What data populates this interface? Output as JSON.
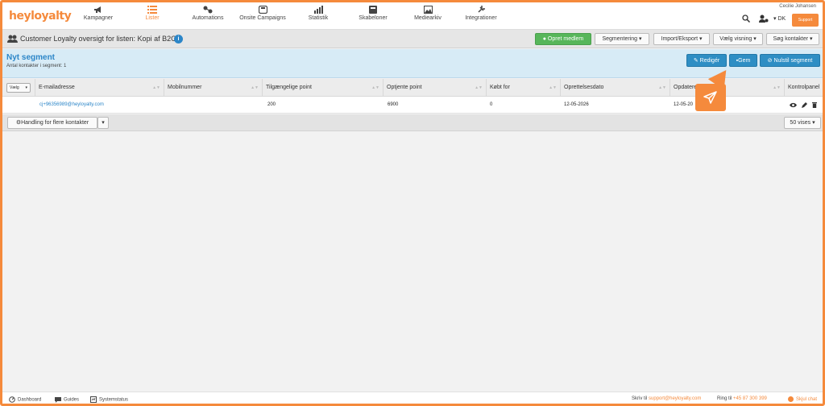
{
  "brand": {
    "logo_text": "heyloyalty",
    "accent": "#f58a3c",
    "blue": "#2c86c8",
    "green": "#57b65a"
  },
  "nav": {
    "items": [
      {
        "label": "Kampagner",
        "icon": "megaphone-icon"
      },
      {
        "label": "Lister",
        "icon": "list-icon",
        "active": true
      },
      {
        "label": "Automations",
        "icon": "automations-icon"
      },
      {
        "label": "Onsite Campaigns",
        "icon": "onsite-icon"
      },
      {
        "label": "Statistik",
        "icon": "bar-chart-icon"
      },
      {
        "label": "Skabeloner",
        "icon": "template-icon"
      },
      {
        "label": "Mediearkiv",
        "icon": "image-icon"
      },
      {
        "label": "Integrationer",
        "icon": "plug-icon"
      }
    ],
    "user_name": "Cecilie Johansen",
    "language": "DK",
    "support_label": "Support"
  },
  "titlebar": {
    "title": "Customer Loyalty oversigt for listen: Kopi af B2C",
    "info_label": "i",
    "create_member": "Opret medlem",
    "segmentation": "Segmentering",
    "import_export": "Import/Eksport",
    "choose_view": "Vælg visning",
    "search_contacts": "Søg kontakter"
  },
  "segment": {
    "title": "Nyt segment",
    "count_label": "Antal kontakter i segment: 1",
    "edit_label": "Redigér",
    "save_label": "Gem",
    "reset_label": "Nulstil segment"
  },
  "table": {
    "select_label": "Vælg",
    "columns": [
      "E-mailadresse",
      "Mobilnummer",
      "Tilgængelige point",
      "Optjente point",
      "Købt for",
      "Oprettelsesdato",
      "Opdateret",
      "Kontrolpanel"
    ],
    "rows": [
      {
        "email": "cj+96356989@heyloyalty.com",
        "mobile": "",
        "available_points": "200",
        "earned_points": "6900",
        "bought_for": "0",
        "created": "12-05-2026",
        "updated": "12-05-20"
      }
    ]
  },
  "actions": {
    "bulk_label": "Handling for flere kontakter",
    "per_page": "50 vises"
  },
  "footer": {
    "dashboard": "Dashboard",
    "guides": "Guides",
    "system_status": "Systemstatus",
    "write_prefix": "Skriv til",
    "email": "support@heyloyalty.com",
    "call_prefix": "Ring til",
    "phone": "+45 87 300 399",
    "hide_chat": "Skjul chat"
  }
}
